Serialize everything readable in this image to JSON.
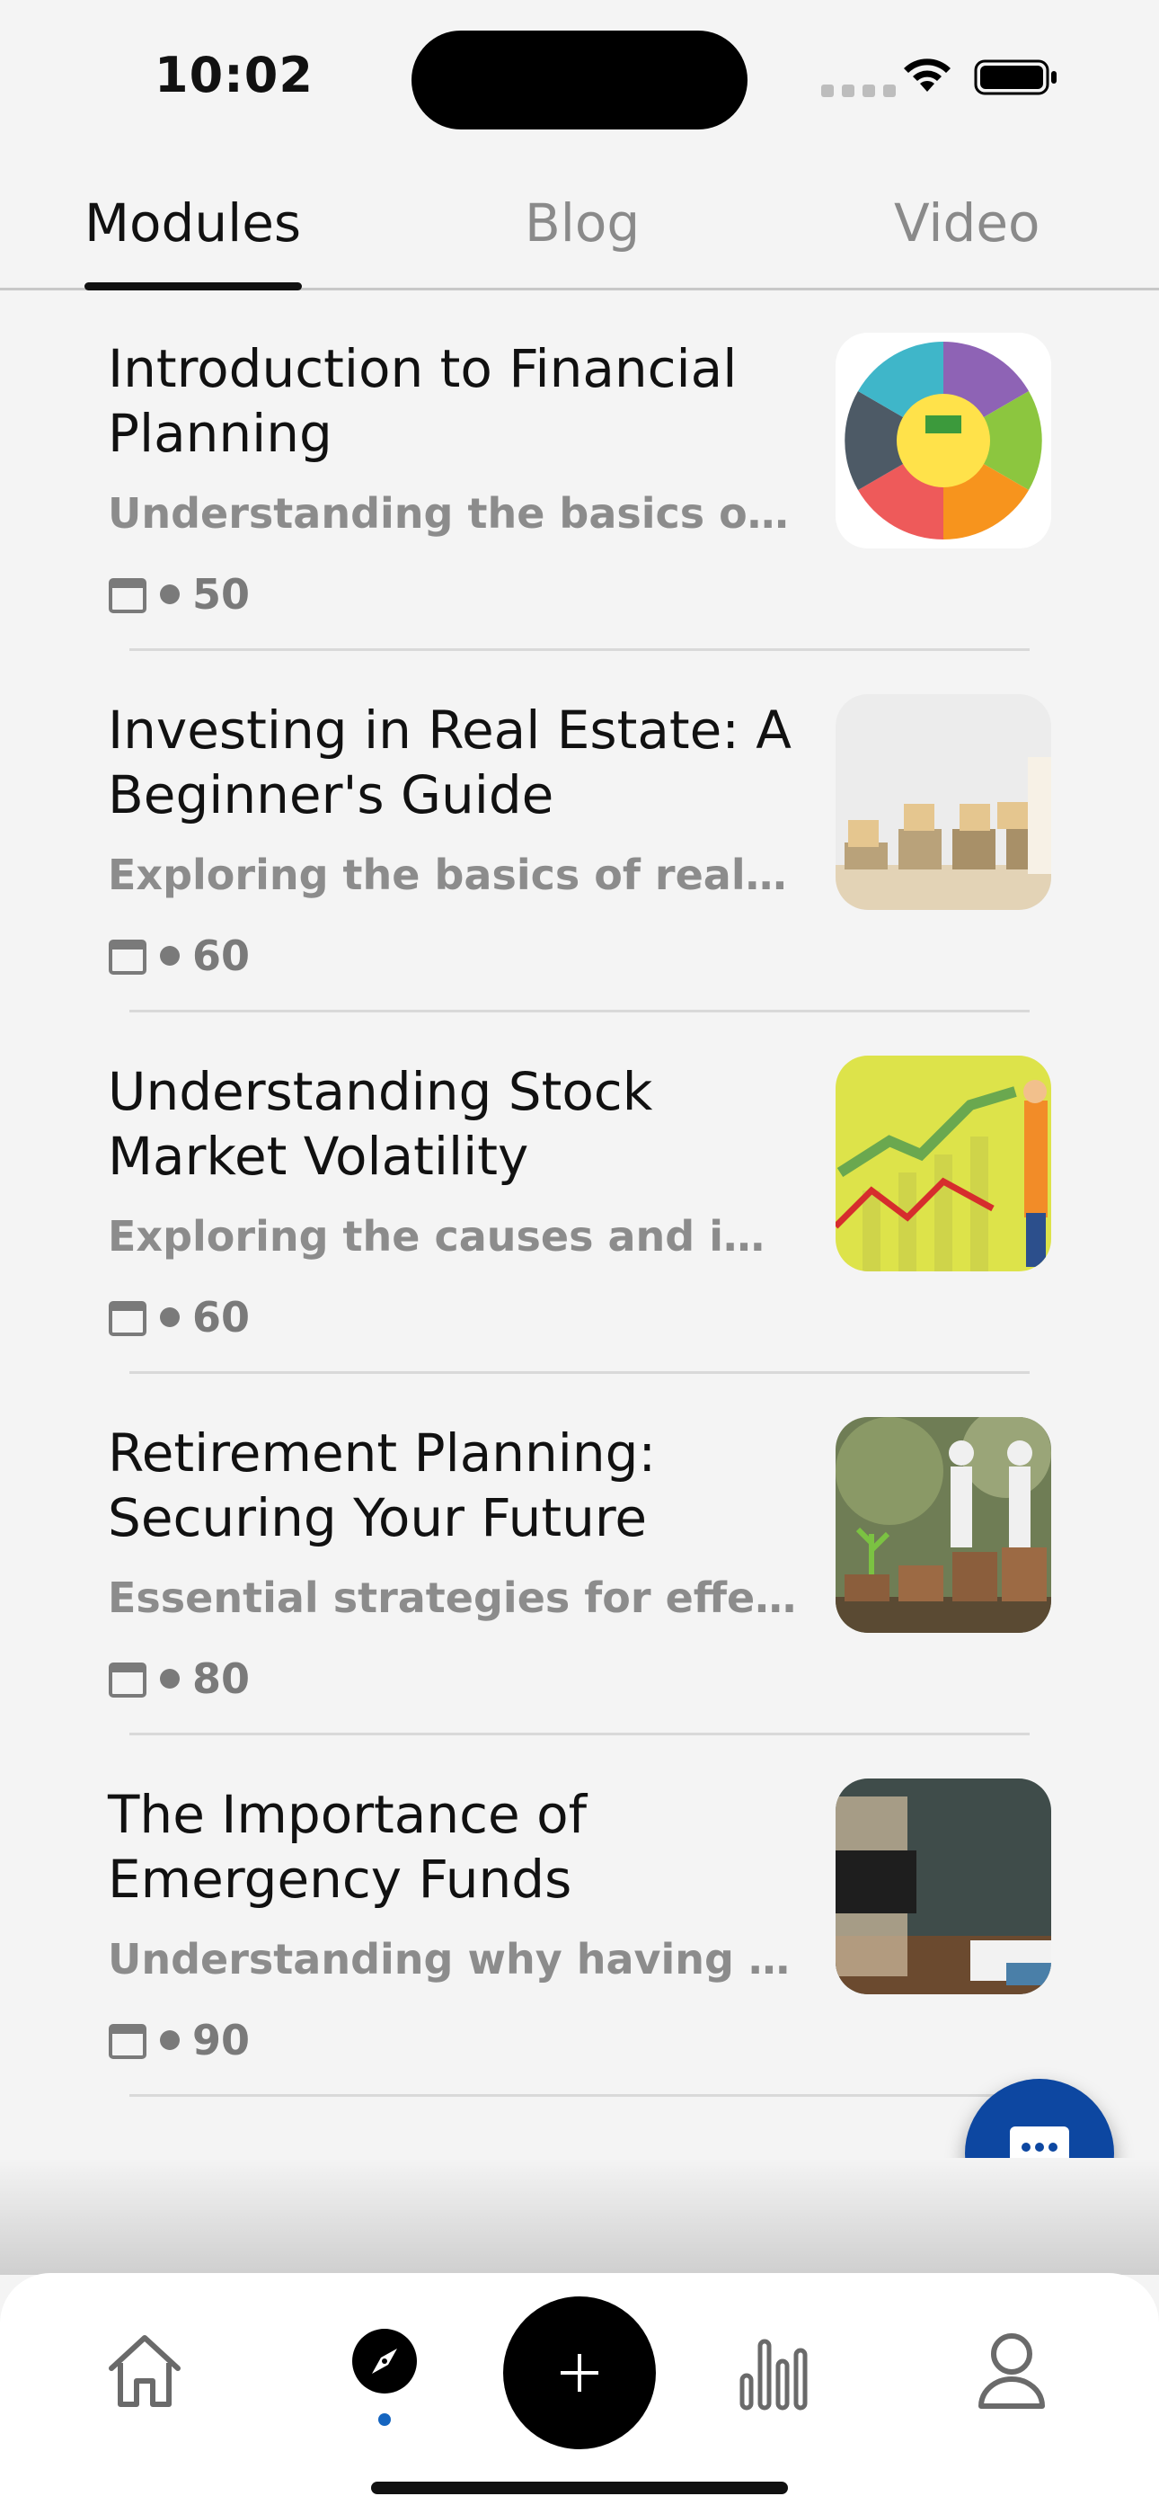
{
  "status_bar": {
    "time": "10:02",
    "icons": [
      "cellular-signal-icon",
      "wifi-icon",
      "battery-icon"
    ]
  },
  "tabs": [
    {
      "label": "Modules",
      "active": true
    },
    {
      "label": "Blog",
      "active": false
    },
    {
      "label": "Video",
      "active": false
    }
  ],
  "modules": [
    {
      "title": "Introduction to Financial Planning",
      "description": "Understanding the basics of fi...",
      "value": "50",
      "thumbnail": "financial-planning-process-image"
    },
    {
      "title": "Investing in Real Estate: A Beginner's Guide",
      "description": "Exploring the basics of real es...",
      "value": "60",
      "thumbnail": "invest-blocks-coins-image"
    },
    {
      "title": "Understanding Stock Market Volatility",
      "description": "Exploring the causes and impl...",
      "value": "60",
      "thumbnail": "stock-chart-image"
    },
    {
      "title": "Retirement Planning: Securing Your Future",
      "description": "Essential strategies for effecti...",
      "value": "80",
      "thumbnail": "retirement-coins-image"
    },
    {
      "title": "The Importance of Emergency Funds",
      "description": "Understanding why having an...",
      "value": "90",
      "thumbnail": "emergency-fund-jar-image"
    }
  ],
  "bottom_nav": {
    "items": [
      "home-icon",
      "compass-icon",
      "add-icon",
      "bar-chart-icon",
      "profile-icon"
    ],
    "active": "compass-icon"
  },
  "colors": {
    "accent": "#0d47a1",
    "background": "#f4f4f4",
    "secondary_text": "#8c8c8c"
  }
}
